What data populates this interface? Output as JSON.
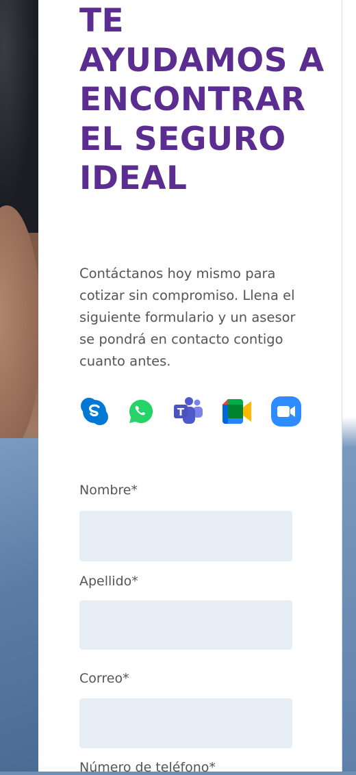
{
  "headline": "TE AYUDAMOS A ENCONTRAR EL SEGURO IDEAL",
  "intro": "Contáctanos hoy mismo para cotizar sin compromiso. Llena el siguiente formulario y un asesor se pondrá en contacto contigo cuanto antes.",
  "contact_apps": [
    {
      "name": "skype-icon",
      "color": "#0078d4"
    },
    {
      "name": "whatsapp-icon",
      "color": "#25d366"
    },
    {
      "name": "microsoft-teams-icon",
      "color": "#5059c9"
    },
    {
      "name": "google-meet-icon",
      "color": "#00832d"
    },
    {
      "name": "zoom-icon",
      "color": "#2d8cff"
    }
  ],
  "form": {
    "fields": [
      {
        "label": "Nombre*",
        "value": ""
      },
      {
        "label": "Apellido*",
        "value": ""
      },
      {
        "label": "Correo*",
        "value": ""
      },
      {
        "label": "Número de teléfono*",
        "value": ""
      }
    ]
  },
  "colors": {
    "headline": "#5b2d90",
    "body_text": "#555555",
    "input_background": "#e8eef5"
  }
}
